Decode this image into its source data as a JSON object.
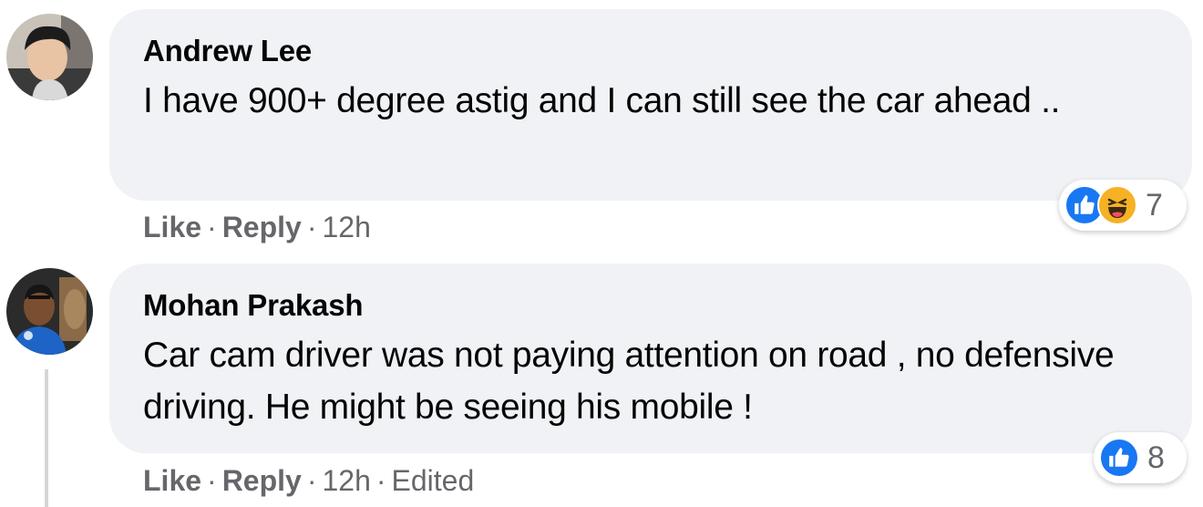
{
  "comments": [
    {
      "author": "Andrew Lee",
      "text": "I have 900+ degree astig and I can still see the car ahead ..",
      "actions": {
        "like": "Like",
        "reply": "Reply",
        "time": "12h",
        "edited": ""
      },
      "reactions": {
        "icons": [
          "like-icon",
          "haha-icon"
        ],
        "count": "7"
      }
    },
    {
      "author": "Mohan Prakash",
      "text": "Car cam driver was not paying attention on road , no defensive driving. He might be seeing his mobile !",
      "actions": {
        "like": "Like",
        "reply": "Reply",
        "time": "12h",
        "edited": "Edited"
      },
      "reactions": {
        "icons": [
          "like-icon"
        ],
        "count": "8"
      }
    }
  ],
  "colors": {
    "bubble": "#f0f2f5",
    "like_blue": "#1877f2",
    "haha_yellow": "#f7b125",
    "meta_gray": "#65676b"
  }
}
